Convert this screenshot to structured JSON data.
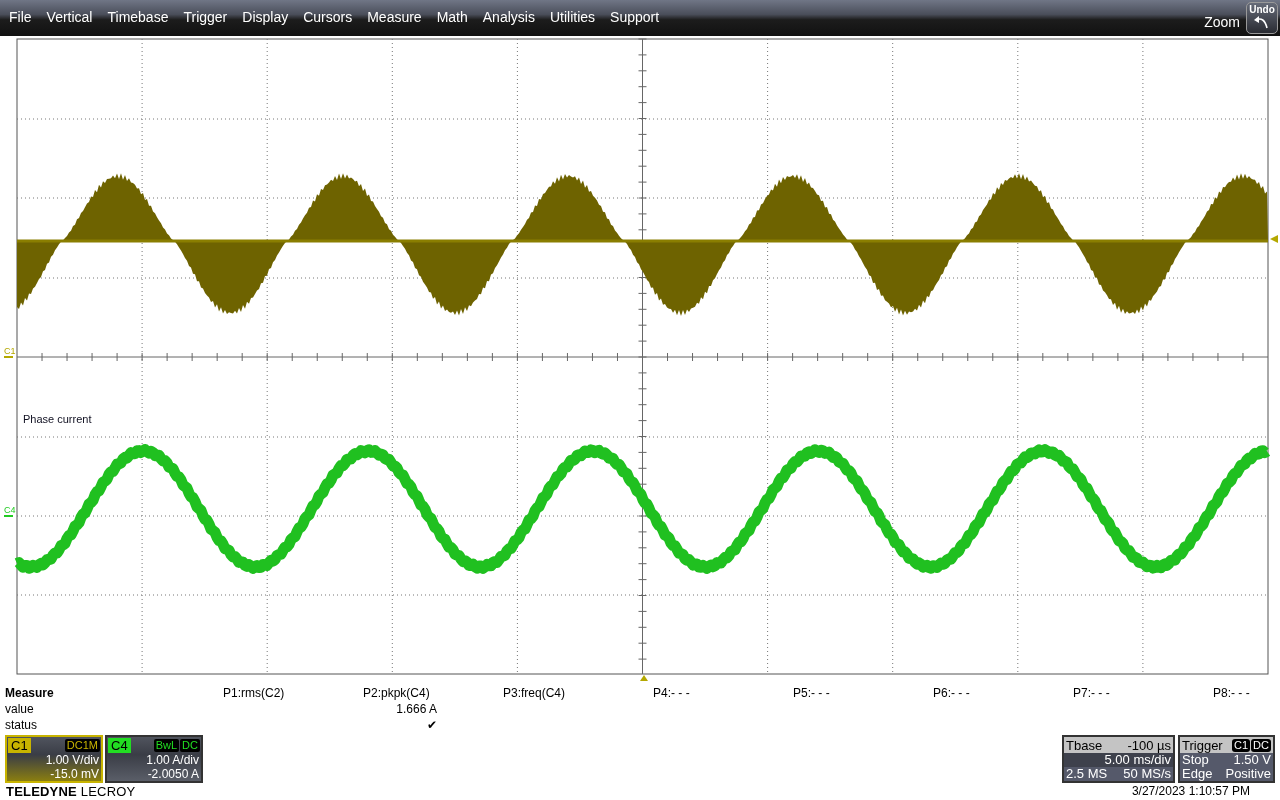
{
  "menu": [
    "File",
    "Vertical",
    "Timebase",
    "Trigger",
    "Display",
    "Cursors",
    "Measure",
    "Math",
    "Analysis",
    "Utilities",
    "Support"
  ],
  "zoom_label": "Zoom",
  "undo_button": "Undo",
  "grid": {
    "traces": [
      {
        "label": "C1",
        "color": "#b4a800"
      },
      {
        "label": "C4",
        "color": "#22cc22"
      }
    ],
    "annotation": "Phase current"
  },
  "measure": {
    "title": "Measure",
    "row_labels": [
      "value",
      "status"
    ],
    "params": [
      {
        "name": "P1:rms(C2)"
      },
      {
        "name": "P2:pkpk(C4)",
        "value": "1.666 A",
        "status": "✔"
      },
      {
        "name": "P3:freq(C4)"
      },
      {
        "name": "P4:- - -"
      },
      {
        "name": "P5:- - -"
      },
      {
        "name": "P6:- - -"
      },
      {
        "name": "P7:- - -"
      },
      {
        "name": "P8:- - -"
      }
    ]
  },
  "channels": [
    {
      "label": "C1",
      "color": "#c8b400",
      "selected": true,
      "tags": [
        "DC1M"
      ],
      "scale": "1.00 V/div",
      "offset": "-15.0 mV"
    },
    {
      "label": "C4",
      "color": "#22dd22",
      "selected": false,
      "tags": [
        "BwL",
        "DC"
      ],
      "scale": "1.00 A/div",
      "offset": "-2.0050 A"
    }
  ],
  "timebase": {
    "title": "Tbase",
    "delay": "-100 µs",
    "scale": "5.00 ms/div",
    "samples": "2.5 MS",
    "rate": "50 MS/s"
  },
  "trigger": {
    "title": "Trigger",
    "tags": [
      "C1",
      "DC"
    ],
    "mode": "Stop",
    "level": "1.50 V",
    "type": "Edge",
    "slope": "Positive"
  },
  "logo": "**TELEDYNE** LECROY",
  "timestamp": "3/27/2023 1:10:57 PM"
}
